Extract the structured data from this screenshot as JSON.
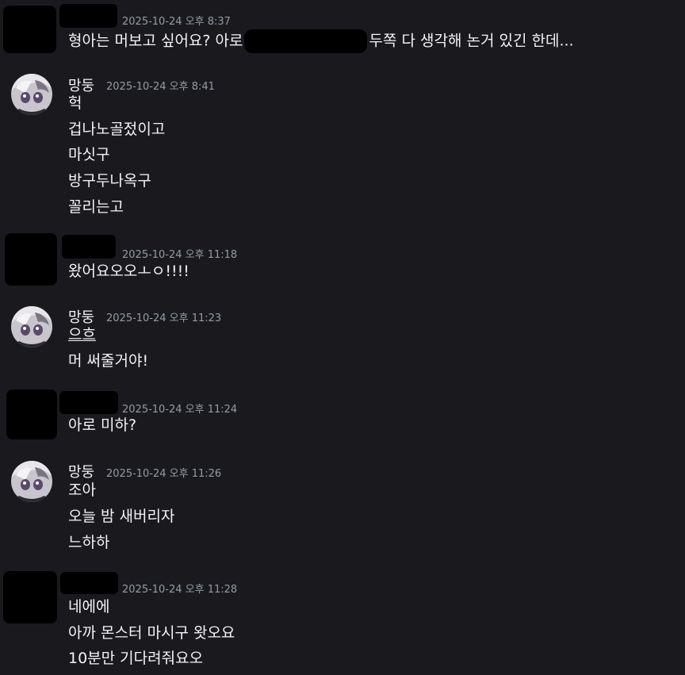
{
  "messages": [
    {
      "author": "",
      "timestamp": "2025-10-24 오후 8:37",
      "lines": [
        "형아는 머보고 싶어요? 아로",
        "두쪽 다 생각해 논거 있긴 한데..."
      ]
    },
    {
      "author": "망둥",
      "timestamp": "2025-10-24 오후 8:41",
      "lines": [
        "헉",
        "겁나노골젔이고",
        "마싯구",
        "방구두나옥구",
        "꼴리는고"
      ]
    },
    {
      "author": "",
      "timestamp": "2025-10-24 오후 11:18",
      "lines": [
        "왔어요오오ㅗㅇ!!!!"
      ]
    },
    {
      "author": "망둥",
      "timestamp": "2025-10-24 오후 11:23",
      "lines": [
        "으흐",
        "머 써줄거야!"
      ]
    },
    {
      "author": "",
      "timestamp": "2025-10-24 오후 11:24",
      "lines": [
        "아로 미하?"
      ]
    },
    {
      "author": "망둥",
      "timestamp": "2025-10-24 오후 11:26",
      "lines": [
        "조아",
        "오늘 밤 새버리자",
        "느하하"
      ]
    },
    {
      "author": "",
      "timestamp": "2025-10-24 오후 11:28",
      "lines": [
        "네에에",
        "아까 몬스터 마시구 왓오요",
        "10분만 기다려줘요오"
      ]
    }
  ],
  "colors": {
    "background": "#1a1a1e",
    "text": "#f2f3f5",
    "timestamp": "#949ba4",
    "redaction": "#000000"
  },
  "icons": {
    "bot_avatar": "anime-character-avatar"
  }
}
